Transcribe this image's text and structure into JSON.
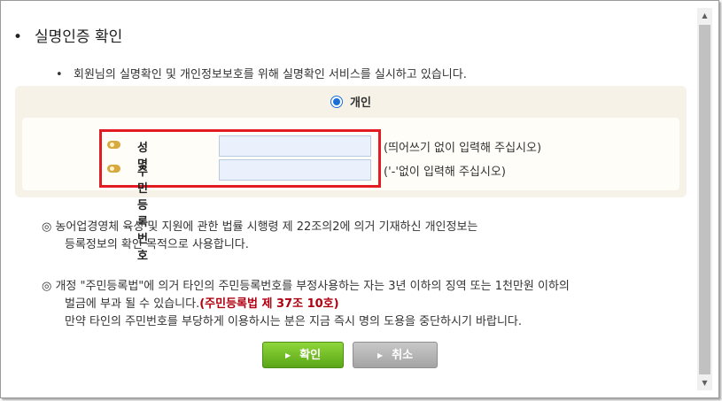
{
  "title": "실명인증 확인",
  "intro": "회원님의 실명확인 및 개인정보보호를 위해 실명확인 서비스를 실시하고 있습니다.",
  "radio": {
    "label": "개인",
    "checked": true
  },
  "fields": {
    "name_label": "성　　명",
    "name_value": "",
    "name_hint": "(띄어쓰기 없이 입력해 주십시오)",
    "rrn_label": "주민등록번호",
    "rrn_value": "",
    "rrn_hint": "('-'없이 입력해 주십시오)"
  },
  "notice1": {
    "line1": "◎ 농어업경영체 육성 및 지원에 관한 법률 시행령 제 22조의2에 의거 기재하신 개인정보는",
    "line2": "등록정보의 확인 목적으로 사용합니다."
  },
  "notice2": {
    "line1": "◎ 개정 \"주민등록법\"에 의거 타인의 주민등록번호를 부정사용하는 자는 3년 이하의 징역 또는 1천만원 이하의",
    "line2": "벌금에 부과 될 수 있습니다.",
    "law": "(주민등록법 제 37조 10호)",
    "line3": "만약 타인의 주민번호를 부당하게 이용하시는 분은 지금 즉시 명의 도용을 중단하시기 바랍니다."
  },
  "buttons": {
    "confirm": "확인",
    "cancel": "취소"
  },
  "colors": {
    "highlight_border": "#e31b23",
    "confirm_green": "#6cbf24",
    "law_red": "#b00010"
  }
}
